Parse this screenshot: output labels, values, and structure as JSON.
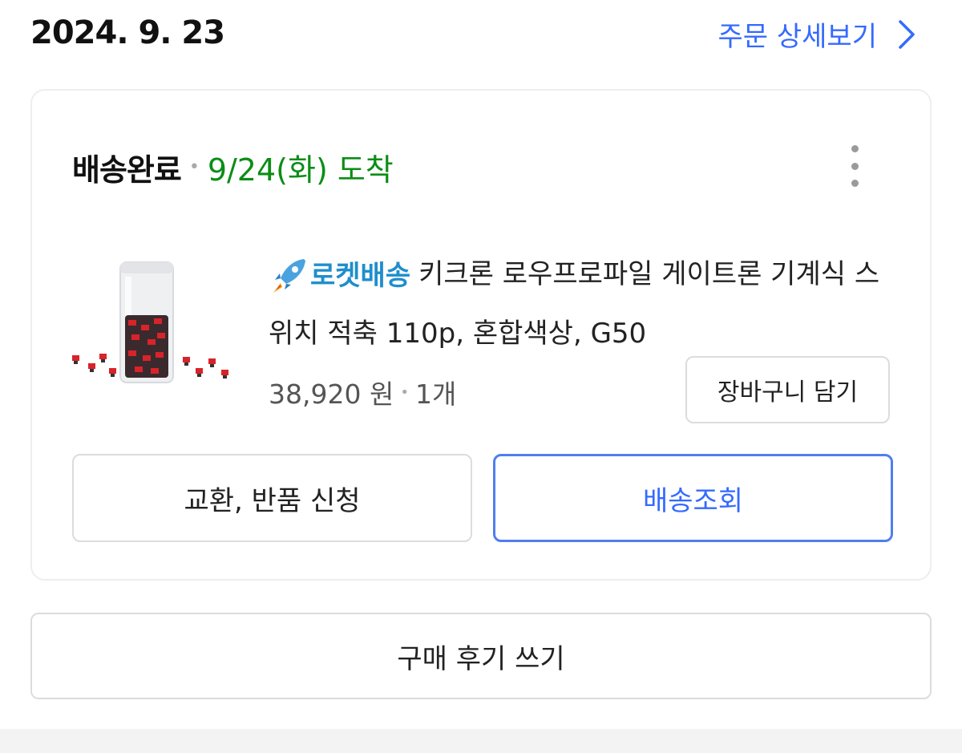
{
  "order": {
    "date": "2024. 9. 23",
    "detail_link_label": "주문 상세보기"
  },
  "card": {
    "status": "배송완료",
    "arrival": "9/24(화) 도착",
    "product": {
      "badge": "로켓배송",
      "name": "키크론 로우프로파일 게이트론 기계식 스위치 적축 110p, 혼합색상, G50",
      "price": "38,920 원",
      "quantity": "1개"
    },
    "cart_button_label": "장바구니 담기",
    "return_button_label": "교환, 반품 신청",
    "track_button_label": "배송조회"
  },
  "review_button_label": "구매 후기 쓰기",
  "icons": {
    "more": "more-vertical-icon",
    "chevron": "chevron-right-icon",
    "rocket": "rocket-icon",
    "thumbnail": "product-thumbnail"
  },
  "colors": {
    "accent": "#346aff",
    "arrival": "#0c8d16",
    "rocket": "#1f8ecd"
  }
}
